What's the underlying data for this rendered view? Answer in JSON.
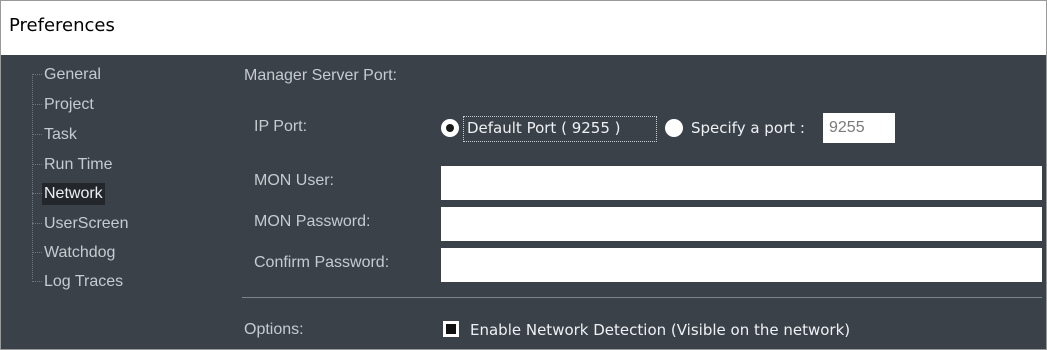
{
  "window": {
    "title": "Preferences"
  },
  "tree": {
    "items": [
      {
        "label": "General",
        "selected": false
      },
      {
        "label": "Project",
        "selected": false
      },
      {
        "label": "Task",
        "selected": false
      },
      {
        "label": "Run Time",
        "selected": false
      },
      {
        "label": "Network",
        "selected": true
      },
      {
        "label": "UserScreen",
        "selected": false
      },
      {
        "label": "Watchdog",
        "selected": false
      },
      {
        "label": "Log Traces",
        "selected": false
      }
    ]
  },
  "network": {
    "section_title": "Manager Server Port:",
    "ip_port_label": "IP Port:",
    "default_port_label": "Default Port ( 9255 )",
    "default_port_selected": true,
    "specify_port_label": "Specify a port :",
    "specify_port_selected": false,
    "port_value": "9255",
    "mon_user_label": "MON User:",
    "mon_user_value": "",
    "mon_password_label": "MON Password:",
    "mon_password_value": "",
    "confirm_password_label": "Confirm Password:",
    "confirm_password_value": "",
    "options_label": "Options:",
    "enable_detection_label": "Enable Network Detection (Visible on the network)",
    "enable_detection_checked": true
  }
}
